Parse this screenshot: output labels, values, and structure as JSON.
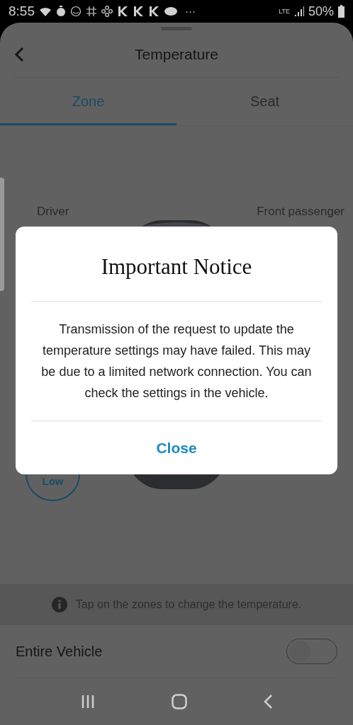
{
  "status_bar": {
    "time": "8:55",
    "more": "···",
    "network": "LTE",
    "battery": "50%"
  },
  "header": {
    "title": "Temperature"
  },
  "tabs": [
    {
      "label": "Zone",
      "selected": true
    },
    {
      "label": "Seat",
      "selected": false
    }
  ],
  "zones": {
    "driver_label": "Driver",
    "passenger_label": "Front passenger",
    "driver_level": "Low"
  },
  "info": "Tap on the zones to change the temperature.",
  "entire_vehicle": {
    "label": "Entire Vehicle",
    "on": false
  },
  "dialog": {
    "title": "Important Notice",
    "message": "Transmission of the request to update the temperature settings may have failed. This may be due to a limited network connection. You can check the settings in the vehicle.",
    "button": "Close"
  }
}
